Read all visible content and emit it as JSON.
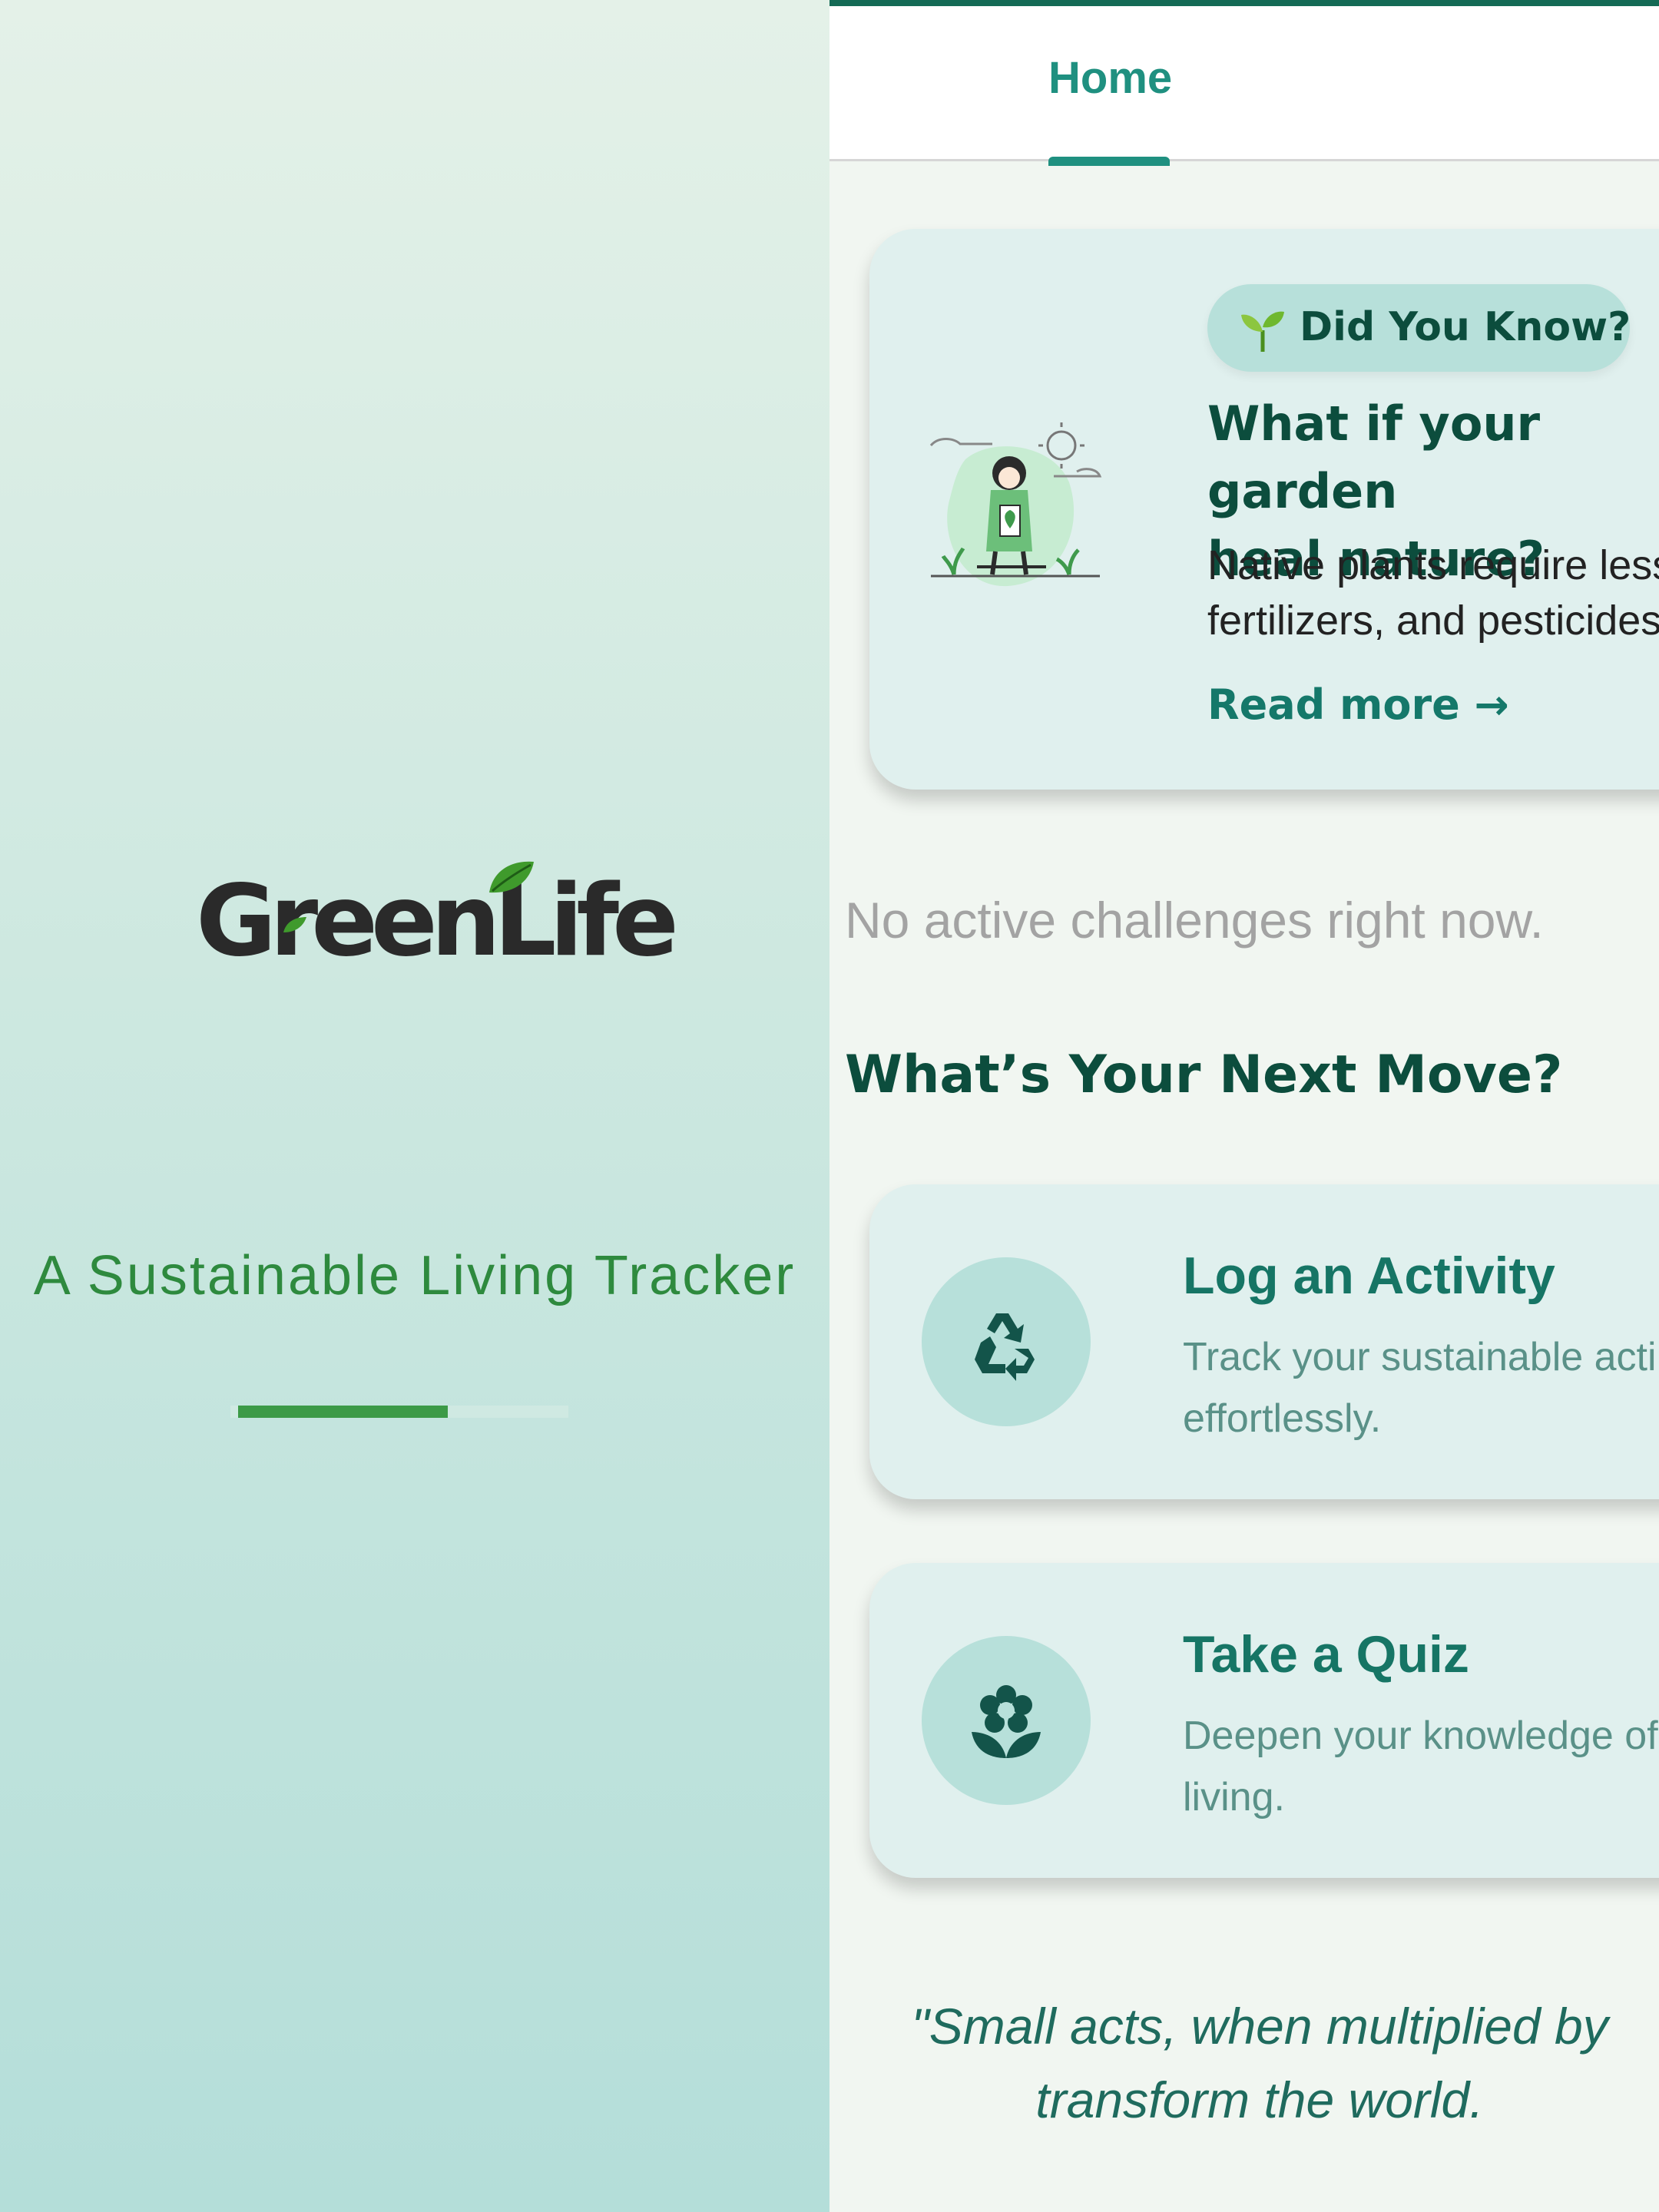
{
  "splash": {
    "logo_text": "GreenLife",
    "tagline": "A Sustainable Living Tracker",
    "loading_progress": 0.65
  },
  "app": {
    "tabs": [
      {
        "label": "Home",
        "selected": true
      }
    ],
    "fact_card": {
      "badge_icon": "seedling-icon",
      "badge_label": "Did You Know?",
      "title": "What if your garden could heal nature?",
      "title_line1": "What if your garden",
      "title_line2": "heal nature?",
      "body_line1": "Native plants require less",
      "body_line2": "fertilizers, and pesticides.",
      "link_label": "Read more →",
      "illustration": "gardener-with-plant-illustration"
    },
    "empty_challenges": "No active challenges right now.",
    "section_title": "What’s Your Next Move?",
    "actions": [
      {
        "icon": "recycle-icon",
        "title": "Log an Activity",
        "desc_line1": "Track your sustainable acti",
        "desc_line2": "effortlessly."
      },
      {
        "icon": "flower-icon",
        "title": "Take a Quiz",
        "desc_line1": "Deepen your knowledge of",
        "desc_line2": "living."
      }
    ],
    "quote_line1": "\"Small acts, when multiplied by",
    "quote_line2": "transform the world."
  },
  "colors": {
    "brand_dark": "#0c4d3d",
    "accent": "#1f9080",
    "card_bg": "#e0f0ee",
    "badge_bg": "#b7e0da",
    "tagline": "#2e8a3e",
    "progress": "#3c9a47"
  }
}
